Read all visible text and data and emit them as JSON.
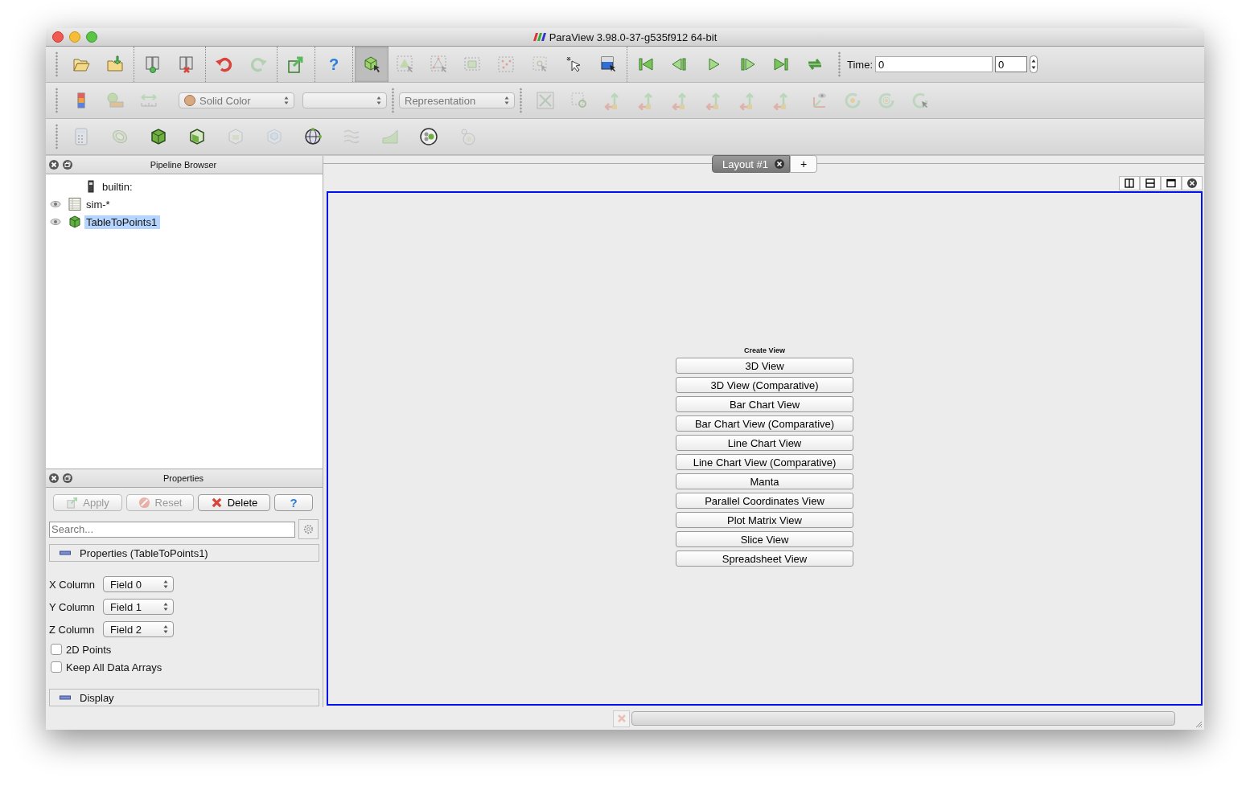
{
  "window": {
    "title": "ParaView 3.98.0-37-g535f912 64-bit"
  },
  "toolbar_row_1": {
    "groups": [
      {
        "buttons": [
          {
            "disabled": false
          },
          {
            "disabled": false
          }
        ]
      },
      {
        "buttons": [
          {
            "disabled": false
          },
          {
            "disabled": false
          }
        ]
      },
      {
        "buttons": [
          {
            "disabled": false
          },
          {
            "disabled": true
          }
        ]
      },
      {
        "buttons": [
          {
            "disabled": false
          }
        ]
      },
      {
        "buttons": [
          {
            "disabled": false,
            "glyph": "?"
          }
        ]
      },
      {
        "buttons": [
          {
            "disabled": false,
            "pressed": true
          },
          {
            "disabled": true,
            "pressed": false
          },
          {
            "disabled": true,
            "pressed": false
          },
          {
            "disabled": true,
            "pressed": false
          },
          {
            "disabled": true,
            "pressed": false
          },
          {
            "disabled": true,
            "pressed": false
          },
          {
            "disabled": false,
            "pressed": false
          },
          {
            "disabled": false,
            "pressed": false
          }
        ]
      },
      {
        "buttons": [
          {
            "disabled": false
          },
          {
            "disabled": false
          },
          {
            "disabled": false
          },
          {
            "disabled": false
          },
          {
            "disabled": false
          },
          {
            "disabled": false
          }
        ]
      }
    ],
    "time": {
      "label": "Time:",
      "value": "0",
      "step": "0"
    }
  },
  "toolbar_row_2": {
    "buttons_before": [
      {
        "disabled": false
      },
      {
        "disabled": true
      },
      {
        "disabled": true
      }
    ],
    "combos": [
      {
        "value": "Solid Color",
        "kind": "color",
        "disabled": true
      },
      {
        "kind": "plain",
        "disabled": true
      },
      {
        "value": "Representation",
        "kind": "plain",
        "disabled": true
      }
    ],
    "groups": [
      {
        "buttons": [
          {
            "disabled": true
          },
          {
            "disabled": true
          },
          {
            "disabled": true
          },
          {
            "disabled": true
          },
          {
            "disabled": true
          },
          {
            "disabled": true
          },
          {
            "disabled": true
          },
          {
            "disabled": true
          }
        ]
      },
      {
        "buttons": [
          {
            "disabled": true
          },
          {
            "disabled": true
          },
          {
            "disabled": true
          },
          {
            "disabled": true
          }
        ]
      }
    ]
  },
  "toolbar_row_3": {
    "buttons": [
      {
        "disabled": true
      },
      {
        "disabled": true
      },
      {
        "disabled": false
      },
      {
        "disabled": false
      },
      {
        "disabled": true
      },
      {
        "disabled": true
      },
      {
        "disabled": false
      },
      {
        "disabled": true
      },
      {
        "disabled": true
      },
      {
        "disabled": false
      },
      {
        "disabled": true
      }
    ]
  },
  "pipeline_browser": {
    "title": "Pipeline Browser",
    "items": [
      {
        "label": "builtin:",
        "kind": "server",
        "visible": false,
        "selected": false,
        "children": [
          {
            "label": "sim-*",
            "kind": "table",
            "visible": true,
            "selected": false,
            "children": [
              {
                "label": "TableToPoints1",
                "kind": "filter",
                "visible": true,
                "selected": true
              }
            ]
          }
        ]
      }
    ]
  },
  "properties": {
    "title": "Properties",
    "buttons": [
      {
        "label": "Apply",
        "kind": "apply",
        "disabled": true
      },
      {
        "label": "Reset",
        "kind": "reset",
        "disabled": true
      },
      {
        "label": "Delete",
        "kind": "delete",
        "disabled": false
      },
      {
        "label": "?",
        "kind": "help",
        "disabled": false
      }
    ],
    "search": {
      "placeholder": "Search..."
    },
    "sections": [
      {
        "title": "Properties (TableToPoints1)",
        "expanded": true,
        "fields": [
          {
            "label": "X Column",
            "kind": "combo",
            "value": "Field 0"
          },
          {
            "label": "Y Column",
            "kind": "combo",
            "value": "Field 1"
          },
          {
            "label": "Z Column",
            "kind": "combo",
            "value": "Field 2"
          },
          {
            "label": "2D Points",
            "kind": "checkbox",
            "checked": false
          },
          {
            "label": "Keep All Data Arrays",
            "kind": "checkbox",
            "checked": false
          }
        ]
      },
      {
        "title": "Display",
        "expanded": true
      }
    ]
  },
  "layout_tabs": [
    {
      "label": "Layout #1",
      "selected": true
    }
  ],
  "add_tab": "+",
  "status_bar": {
    "progress": {
      "level": 0
    },
    "abort_disabled": true
  },
  "create_view": {
    "title": "Create View",
    "buttons": [
      "3D View",
      "3D View (Comparative)",
      "Bar Chart View",
      "Bar Chart View (Comparative)",
      "Line Chart View",
      "Line Chart View (Comparative)",
      "Manta",
      "Parallel Coordinates View",
      "Plot Matrix View",
      "Slice View",
      "Spreadsheet View"
    ]
  }
}
